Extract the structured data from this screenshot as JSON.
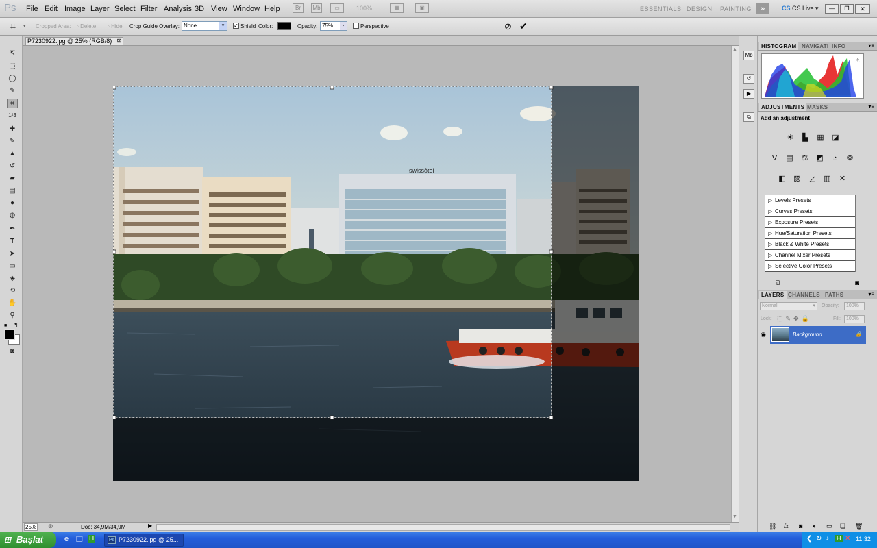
{
  "app": {
    "logo": "Ps"
  },
  "menu": [
    "File",
    "Edit",
    "Image",
    "Layer",
    "Select",
    "Filter",
    "Analysis",
    "3D",
    "View",
    "Window",
    "Help"
  ],
  "appbar": {
    "zoom_level": "100%"
  },
  "workspace": {
    "essentials": "ESSENTIALS",
    "design": "DESIGN",
    "painting": "PAINTING",
    "more": "»",
    "cs_live": "CS Live"
  },
  "options": {
    "cropped_area": "Cropped Area:",
    "delete": "Delete",
    "hide": "Hide",
    "overlay_label": "Crop Guide Overlay:",
    "overlay_value": "None",
    "shield": "Shield",
    "color_label": "Color:",
    "opacity_label": "Opacity:",
    "opacity_value": "75%",
    "perspective": "Perspective",
    "cancel_icon": "cancel-icon",
    "commit_icon": "commit-icon",
    "shield_color": "#000000"
  },
  "document": {
    "tab_title": "P7230922.jpg @ 25% (RGB/8)",
    "zoom": "25%",
    "doc_info": "Doc: 34,9M/34,9M",
    "hotel_sign": "swissôtel"
  },
  "panels": {
    "histogram_tabs": [
      "HISTOGRAM",
      "NAVIGATI",
      "INFO"
    ],
    "adjustments_tabs": [
      "ADJUSTMENTS",
      "MASKS"
    ],
    "add_adjustment": "Add an adjustment",
    "presets": [
      "Levels Presets",
      "Curves Presets",
      "Exposure Presets",
      "Hue/Saturation Presets",
      "Black & White Presets",
      "Channel Mixer Presets",
      "Selective Color Presets"
    ],
    "layers_tabs": [
      "LAYERS",
      "CHANNELS",
      "PATHS"
    ],
    "blend_mode": "Normal",
    "opacity_label": "Opacity:",
    "opacity_value": "100%",
    "lock_label": "Lock:",
    "fill_label": "Fill:",
    "fill_value": "100%",
    "layer_name": "Background"
  },
  "taskbar": {
    "start": "Başlat",
    "task_item": "P7230922.jpg @ 25...",
    "clock": "11:32"
  }
}
